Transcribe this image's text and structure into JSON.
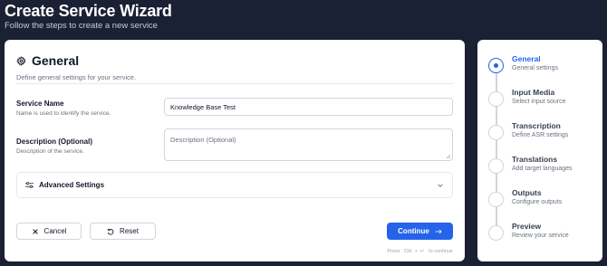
{
  "header": {
    "title": "Create Service Wizard",
    "subtitle": "Follow the steps to create a new service"
  },
  "section": {
    "title": "General",
    "description": "Define general settings for your service.",
    "icon": "gear-icon"
  },
  "fields": {
    "service_name": {
      "label": "Service Name",
      "help": "Name is used to identify the service.",
      "value": "Knowledge Base Test"
    },
    "description": {
      "label": "Description (Optional)",
      "help": "Description of the service.",
      "placeholder": "Description (Optional)",
      "value": ""
    }
  },
  "advanced": {
    "label": "Advanced Settings",
    "icon": "sliders-icon",
    "expanded": false
  },
  "buttons": {
    "cancel": "Cancel",
    "reset": "Reset",
    "continue": "Continue"
  },
  "hint": {
    "press": "Press",
    "ctrl": "Ctrl",
    "plus": "+",
    "enter": "↵",
    "to_continue": "to continue"
  },
  "steps": [
    {
      "name": "General",
      "desc": "General settings",
      "active": true
    },
    {
      "name": "Input Media",
      "desc": "Select input source",
      "active": false
    },
    {
      "name": "Transcription",
      "desc": "Define ASR settings",
      "active": false
    },
    {
      "name": "Translations",
      "desc": "Add target languages",
      "active": false
    },
    {
      "name": "Outputs",
      "desc": "Configure outputs",
      "active": false
    },
    {
      "name": "Preview",
      "desc": "Review your service",
      "active": false
    }
  ],
  "colors": {
    "background": "#1b2134",
    "accent": "#2563eb"
  }
}
